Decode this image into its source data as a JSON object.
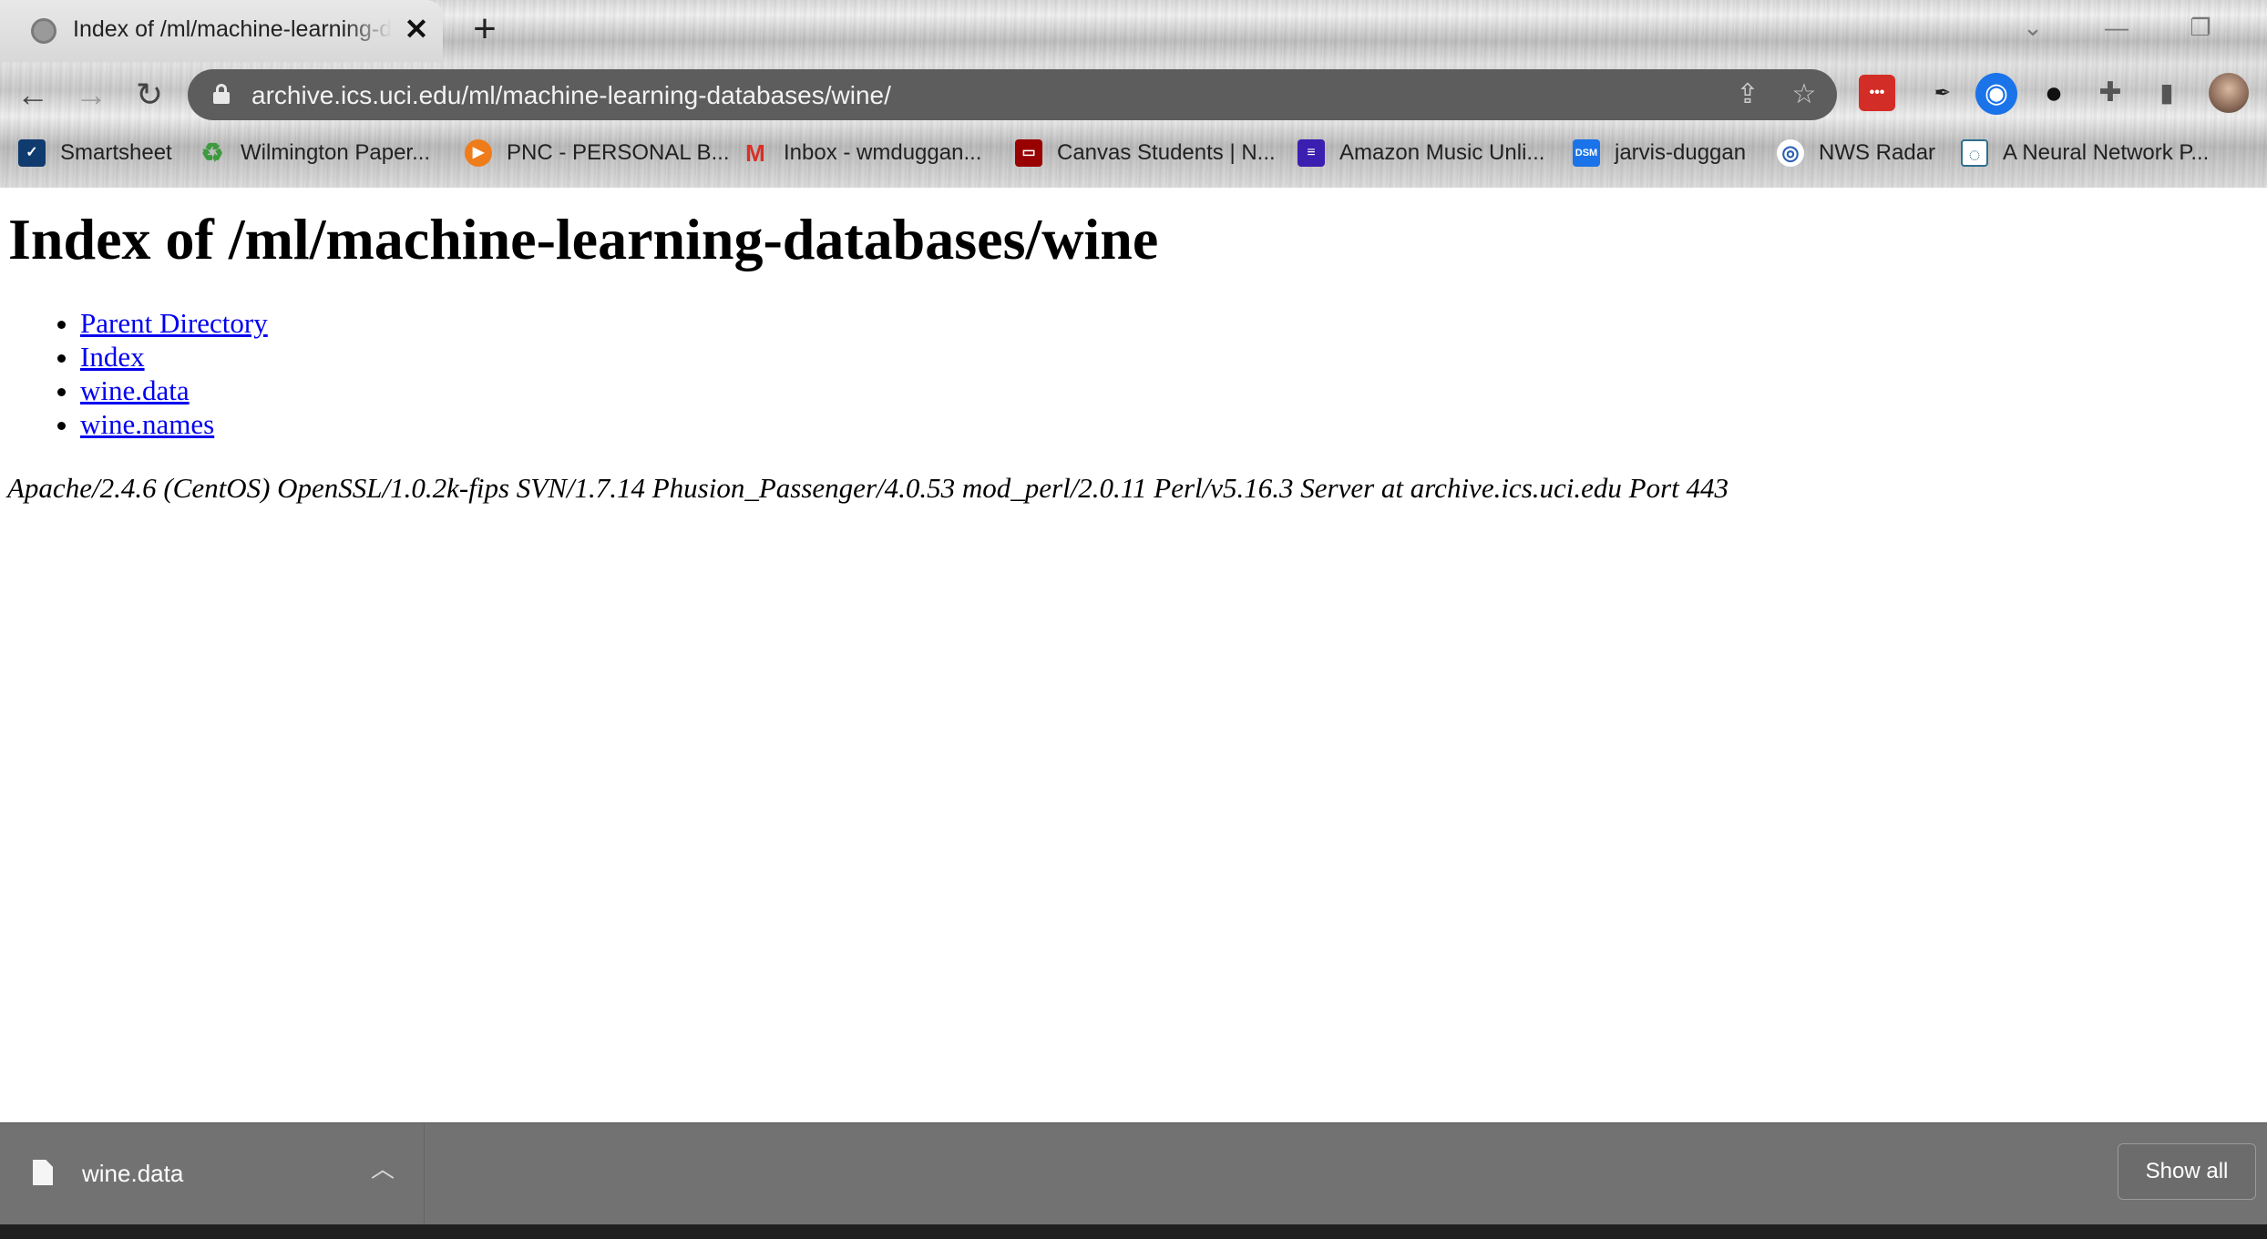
{
  "tab": {
    "title": "Index of /ml/machine-learning-databases/wine",
    "close_glyph": "✕"
  },
  "new_tab_glyph": "+",
  "window_controls": {
    "dropdown": "⌄",
    "minimize": "—",
    "restore": "❐"
  },
  "nav": {
    "back": "←",
    "forward": "→",
    "reload": "↻"
  },
  "address_bar": {
    "url": "archive.ics.uci.edu/ml/machine-learning-databases/wine/"
  },
  "omnibox_icons": {
    "share": "⇪",
    "star": "☆"
  },
  "extensions": [
    {
      "name": "lastpass-icon",
      "glyph": "•••",
      "color": "#d32d27"
    },
    {
      "name": "ink-extension-icon",
      "glyph": "✒",
      "color": "#222222"
    },
    {
      "name": "target-extension-icon",
      "glyph": "◉",
      "color": "#1a73e8"
    },
    {
      "name": "github-icon",
      "glyph": "●",
      "color": "#111111"
    },
    {
      "name": "puzzle-icon",
      "glyph": "✚",
      "color": "#555555"
    },
    {
      "name": "sidepanel-icon",
      "glyph": "▮",
      "color": "#555555"
    }
  ],
  "bookmarks": [
    {
      "label": "Smartsheet",
      "glyph": "✓",
      "color": "#0f3b6f"
    },
    {
      "label": "Wilmington Paper...",
      "glyph": "♻",
      "color": "#3d9a3d"
    },
    {
      "label": "PNC - PERSONAL B...",
      "glyph": "▶",
      "color": "#ef7c1a"
    },
    {
      "label": "Inbox - wmduggan...",
      "glyph": "M",
      "color": "#d93025"
    },
    {
      "label": "Canvas Students | N...",
      "glyph": "▭",
      "color": "#990000"
    },
    {
      "label": "Amazon Music Unli...",
      "glyph": "≡",
      "color": "#3a1fb0"
    },
    {
      "label": "jarvis-duggan",
      "glyph": "DSM",
      "color": "#1a73e8"
    },
    {
      "label": "NWS Radar",
      "glyph": "◎",
      "color": "#2b5fb4"
    },
    {
      "label": "A Neural Network P...",
      "glyph": "◌",
      "color": "#2f6f8f"
    }
  ],
  "page": {
    "heading": "Index of /ml/machine-learning-databases/wine",
    "links": [
      "Parent Directory",
      "Index",
      "wine.data",
      "wine.names"
    ],
    "server_signature": "Apache/2.4.6 (CentOS) OpenSSL/1.0.2k-fips SVN/1.7.14 Phusion_Passenger/4.0.53 mod_perl/2.0.11 Perl/v5.16.3 Server at archive.ics.uci.edu Port 443"
  },
  "download_shelf": {
    "file_name": "wine.data",
    "chevron": "︿",
    "show_all_label": "Show all"
  }
}
